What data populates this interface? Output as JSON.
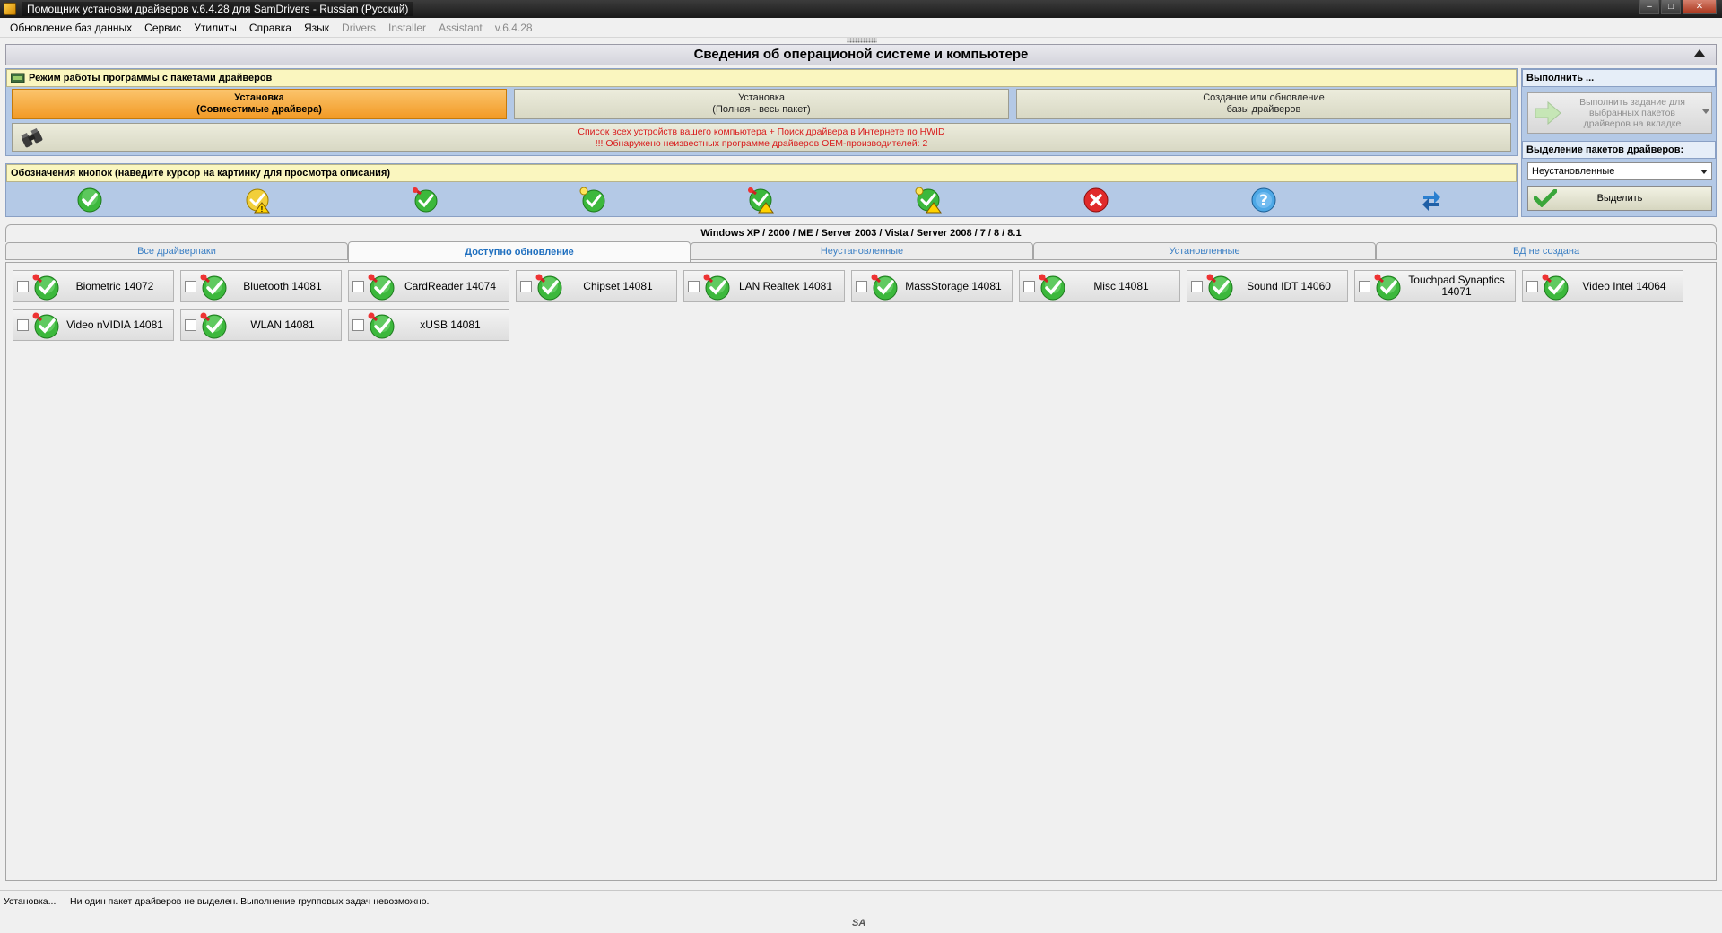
{
  "window": {
    "title": "Помощник установки драйверов v.6.4.28 для SamDrivers - Russian (Русский)"
  },
  "menu": [
    {
      "label": "Обновление баз данных",
      "enabled": true
    },
    {
      "label": "Сервис",
      "enabled": true
    },
    {
      "label": "Утилиты",
      "enabled": true
    },
    {
      "label": "Справка",
      "enabled": true
    },
    {
      "label": "Язык",
      "enabled": true
    },
    {
      "label": "Drivers",
      "enabled": false
    },
    {
      "label": "Installer",
      "enabled": false
    },
    {
      "label": "Assistant",
      "enabled": false
    },
    {
      "label": "v.6.4.28",
      "enabled": false
    }
  ],
  "info_header": "Сведения об операционой системе и компьютере",
  "mode_panel": {
    "title": "Режим работы программы с пакетами драйверов",
    "buttons": [
      {
        "line1": "Установка",
        "line2": "(Совместимые драйвера)",
        "active": true
      },
      {
        "line1": "Установка",
        "line2": "(Полная - весь пакет)",
        "active": false
      },
      {
        "line1": "Создание или обновление",
        "line2": "базы драйверов",
        "active": false
      }
    ],
    "hwid_line1": "Список всех устройств вашего компьютера + Поиск драйвера в Интернете по HWID",
    "hwid_line2": "!!! Обнаружено неизвестных программе драйверов OEM-производителей: 2"
  },
  "legend_panel": {
    "title": "Обозначения кнопок (наведите курсор на картинку для просмотра описания)",
    "icons": [
      "green-check-icon",
      "yellow-check-warning-icon",
      "green-check-pin-icon",
      "green-check-bulb-icon",
      "green-check-pin-warning-icon",
      "green-check-bulb-warning-icon",
      "red-x-icon",
      "blue-question-icon",
      "blue-refresh-arrows-icon"
    ]
  },
  "side_panel": {
    "execute_title": "Выполнить ...",
    "execute_button": "Выполнить задание для выбранных пакетов драйверов на вкладке",
    "select_title": "Выделение пакетов драйверов:",
    "select_value": "Неустановленные",
    "select_button": "Выделить"
  },
  "os_strip": "Windows XP / 2000 / ME / Server 2003 / Vista / Server 2008 / 7 / 8 / 8.1",
  "tabs": [
    {
      "label": "Все драйверпаки",
      "active": false
    },
    {
      "label": "Доступно обновление",
      "active": true
    },
    {
      "label": "Неустановленные",
      "active": false
    },
    {
      "label": "Установленные",
      "active": false
    },
    {
      "label": "БД не создана",
      "active": false
    }
  ],
  "packages": [
    {
      "label": "Biometric 14072",
      "checked": false
    },
    {
      "label": "Bluetooth 14081",
      "checked": false
    },
    {
      "label": "CardReader 14074",
      "checked": false
    },
    {
      "label": "Chipset 14081",
      "checked": false
    },
    {
      "label": "LAN Realtek 14081",
      "checked": false
    },
    {
      "label": "MassStorage 14081",
      "checked": false
    },
    {
      "label": "Misc 14081",
      "checked": false
    },
    {
      "label": "Sound IDT 14060",
      "checked": false
    },
    {
      "label": "Touchpad Synaptics 14071",
      "checked": false
    },
    {
      "label": "Video Intel 14064",
      "checked": false
    },
    {
      "label": "Video nVIDIA 14081",
      "checked": false
    },
    {
      "label": "WLAN 14081",
      "checked": false
    },
    {
      "label": "xUSB 14081",
      "checked": false
    }
  ],
  "status": {
    "mode": "Установка...",
    "message": "Ни один пакет драйверов не выделен. Выполнение групповых задач невозможно.",
    "logo": "SA"
  },
  "colors": {
    "panel_bg": "#b4c9e6",
    "panel_title_bg": "#faf6bf",
    "active_button": "#f29a25",
    "tab_text": "#3b7fc4",
    "alert_text": "#d81b1b"
  }
}
